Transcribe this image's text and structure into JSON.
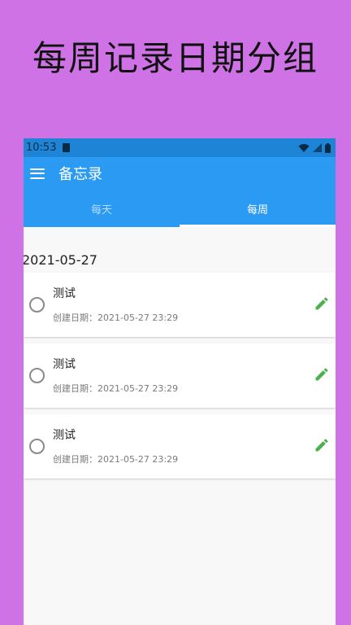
{
  "promo": {
    "title": "每周记录日期分组"
  },
  "status_bar": {
    "time": "10:53"
  },
  "app_bar": {
    "title": "备忘录",
    "menu_icon": "menu-icon"
  },
  "tabs": [
    {
      "label": "每天",
      "active": false
    },
    {
      "label": "每周",
      "active": true
    }
  ],
  "date_group": "2021-05-27",
  "items": [
    {
      "title": "测试",
      "created": "创建日期：2021-05-27 23:29",
      "icon": "pencil-icon"
    },
    {
      "title": "测试",
      "created": "创建日期：2021-05-27 23:29",
      "icon": "pencil-icon"
    },
    {
      "title": "测试",
      "created": "创建日期：2021-05-27 23:29",
      "icon": "pencil-icon"
    }
  ],
  "colors": {
    "background": "#cf72e6",
    "status_bar": "#1e84d6",
    "app_bar": "#2a9af3",
    "edit_icon": "#4caf50"
  }
}
